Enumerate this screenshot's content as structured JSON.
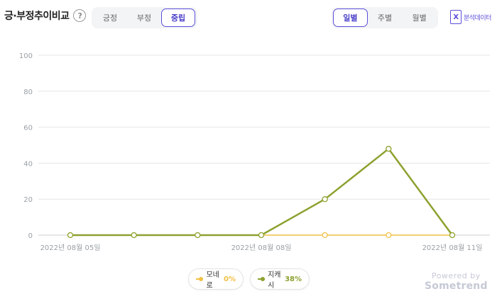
{
  "header": {
    "title": "긍·부정추이비교",
    "help": "?"
  },
  "sentiment_tabs": [
    {
      "label": "긍정",
      "active": false
    },
    {
      "label": "부정",
      "active": false
    },
    {
      "label": "중립",
      "active": true
    }
  ],
  "period_tabs": [
    {
      "label": "일별",
      "active": true
    },
    {
      "label": "주별",
      "active": false
    },
    {
      "label": "월별",
      "active": false
    }
  ],
  "analysis_data": {
    "label": "분석데이터",
    "icon": "excel-icon",
    "icon_glyph": "X"
  },
  "legend": [
    {
      "name": "모네로",
      "pct": "0%",
      "color": "#f2c045"
    },
    {
      "name": "지캐시",
      "pct": "38%",
      "color": "#8ca22f"
    }
  ],
  "powered_by": {
    "line1": "Powered by",
    "line2": "Sometrend"
  },
  "colors": {
    "accent": "#5b4fd9",
    "grid": "#e6e6e6"
  },
  "chart_data": {
    "type": "line",
    "x": [
      "2022-08-05",
      "2022-08-06",
      "2022-08-07",
      "2022-08-08",
      "2022-08-09",
      "2022-08-10",
      "2022-08-11"
    ],
    "x_tick_labels": [
      {
        "index": 0,
        "label": "2022년 08월 05일"
      },
      {
        "index": 3,
        "label": "2022년 08월 08일"
      },
      {
        "index": 6,
        "label": "2022년 08월 11일"
      }
    ],
    "series": [
      {
        "name": "모네로",
        "color": "#f2c045",
        "values": [
          0,
          0,
          0,
          0,
          0,
          0,
          0
        ]
      },
      {
        "name": "지캐시",
        "color": "#8ca22f",
        "values": [
          0,
          0,
          0,
          0,
          20,
          48,
          0
        ]
      }
    ],
    "ylim": [
      0,
      100
    ],
    "yticks": [
      0,
      20,
      40,
      60,
      80,
      100
    ],
    "grid": true,
    "legend_position": "bottom-center"
  }
}
